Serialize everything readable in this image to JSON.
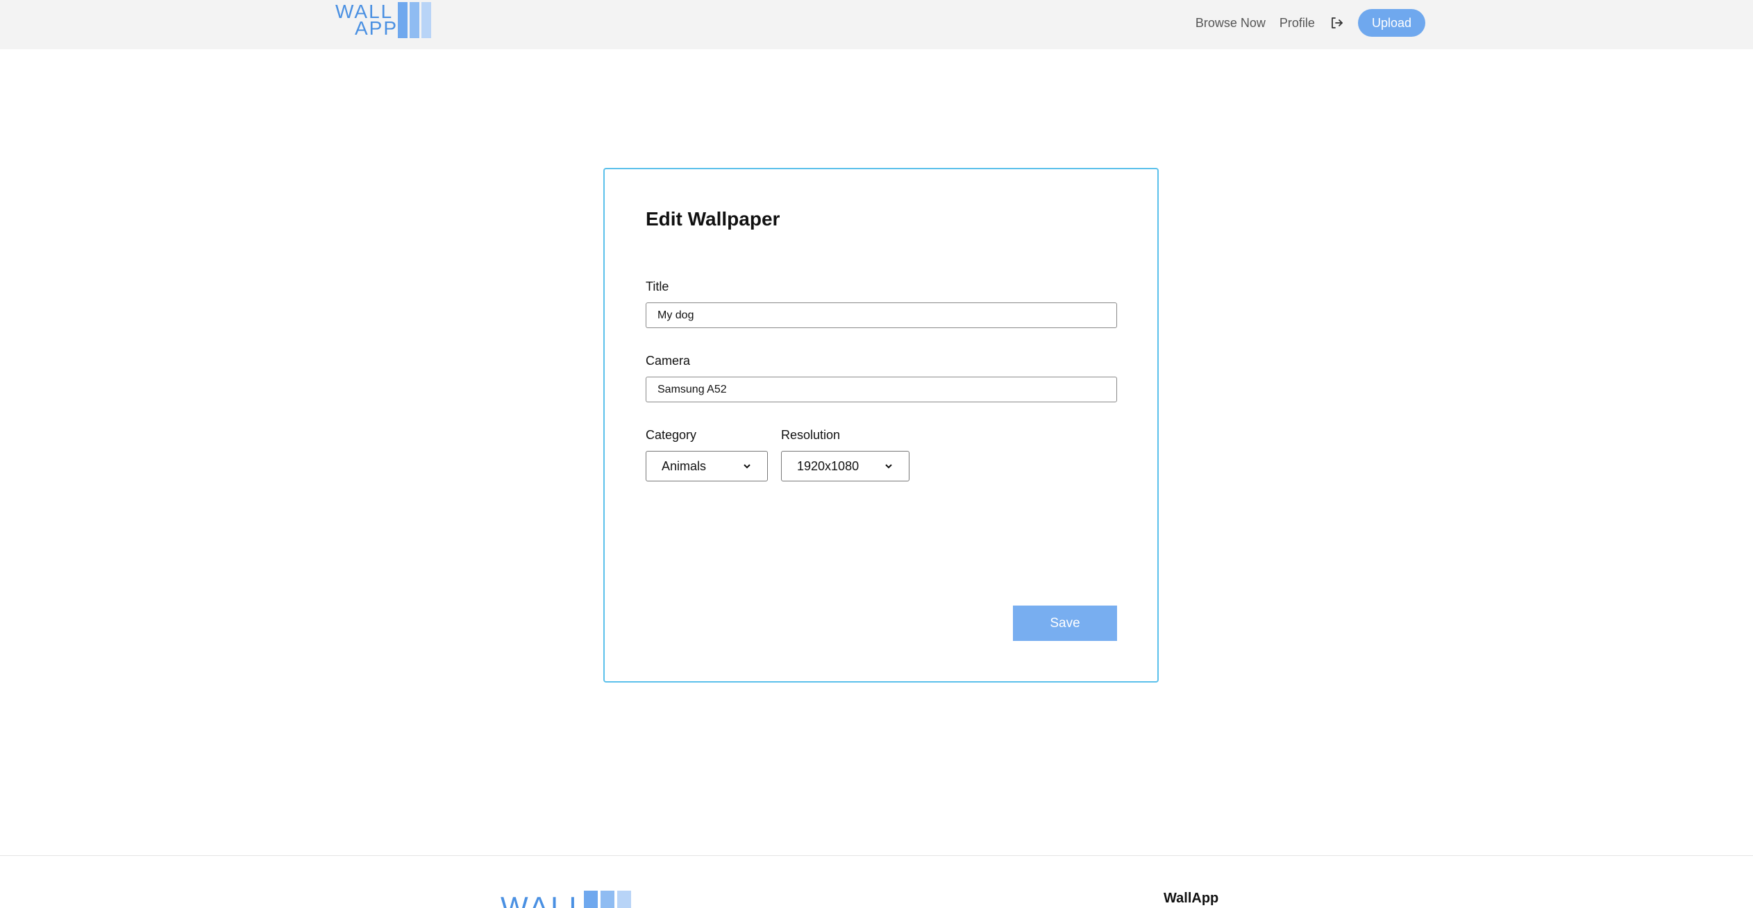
{
  "header": {
    "logo": {
      "line1": "WALL",
      "line2": "APP"
    },
    "nav": {
      "browse_label": "Browse Now",
      "profile_label": "Profile",
      "logout_icon": "logout-icon",
      "upload_label": "Upload"
    }
  },
  "form": {
    "title": "Edit Wallpaper",
    "fields": {
      "title": {
        "label": "Title",
        "value": "My dog"
      },
      "camera": {
        "label": "Camera",
        "value": "Samsung A52"
      },
      "category": {
        "label": "Category",
        "selected": "Animals"
      },
      "resolution": {
        "label": "Resolution",
        "selected": "1920x1080"
      }
    },
    "save_label": "Save"
  },
  "footer": {
    "logo_text": "WALL",
    "brand": "WallApp"
  },
  "colors": {
    "accent": "#6fa8ee",
    "logo_blue": "#4a90e2",
    "card_border": "#5bc0eb",
    "header_bg": "#f3f3f3",
    "bar_dark": "#6fa8ee",
    "bar_mid": "#8fbcf2",
    "bar_light": "#b8d4f7"
  }
}
